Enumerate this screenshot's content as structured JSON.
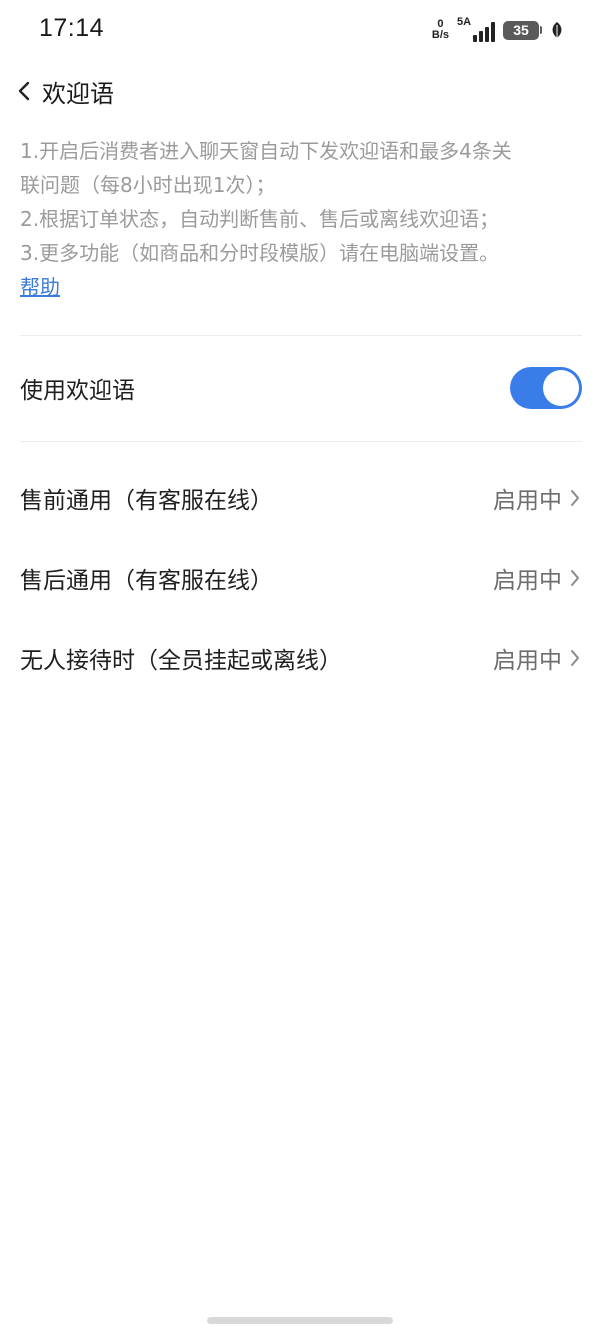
{
  "status_bar": {
    "time": "17:14",
    "net_speed_value": "0",
    "net_speed_unit": "B/s",
    "signal_label": "5A",
    "battery_level": "35",
    "icons": [
      "signal-bars-icon",
      "battery-icon",
      "leaf-icon"
    ]
  },
  "header": {
    "title": "欢迎语",
    "back_icon": "chevron-left-icon"
  },
  "description": {
    "lines": [
      "1.开启后消费者进入聊天窗自动下发欢迎语和最多4条关",
      "联问题（每8小时出现1次）；",
      "2.根据订单状态，自动判断售前、售后或离线欢迎语；",
      "3.更多功能（如商品和分时段模版）请在电脑端设置。"
    ],
    "help_link": "帮助"
  },
  "toggle_setting": {
    "label": "使用欢迎语",
    "enabled": true,
    "accent_color": "#3b7de8"
  },
  "settings_items": [
    {
      "label": "售前通用（有客服在线）",
      "status": "启用中",
      "icon": "chevron-right-icon"
    },
    {
      "label": "售后通用（有客服在线）",
      "status": "启用中",
      "icon": "chevron-right-icon"
    },
    {
      "label": "无人接待时（全员挂起或离线）",
      "status": "启用中",
      "icon": "chevron-right-icon"
    }
  ],
  "colors": {
    "link": "#3b7bd9",
    "description_text": "#9b9b9b",
    "status_text": "#6e6e6e"
  }
}
